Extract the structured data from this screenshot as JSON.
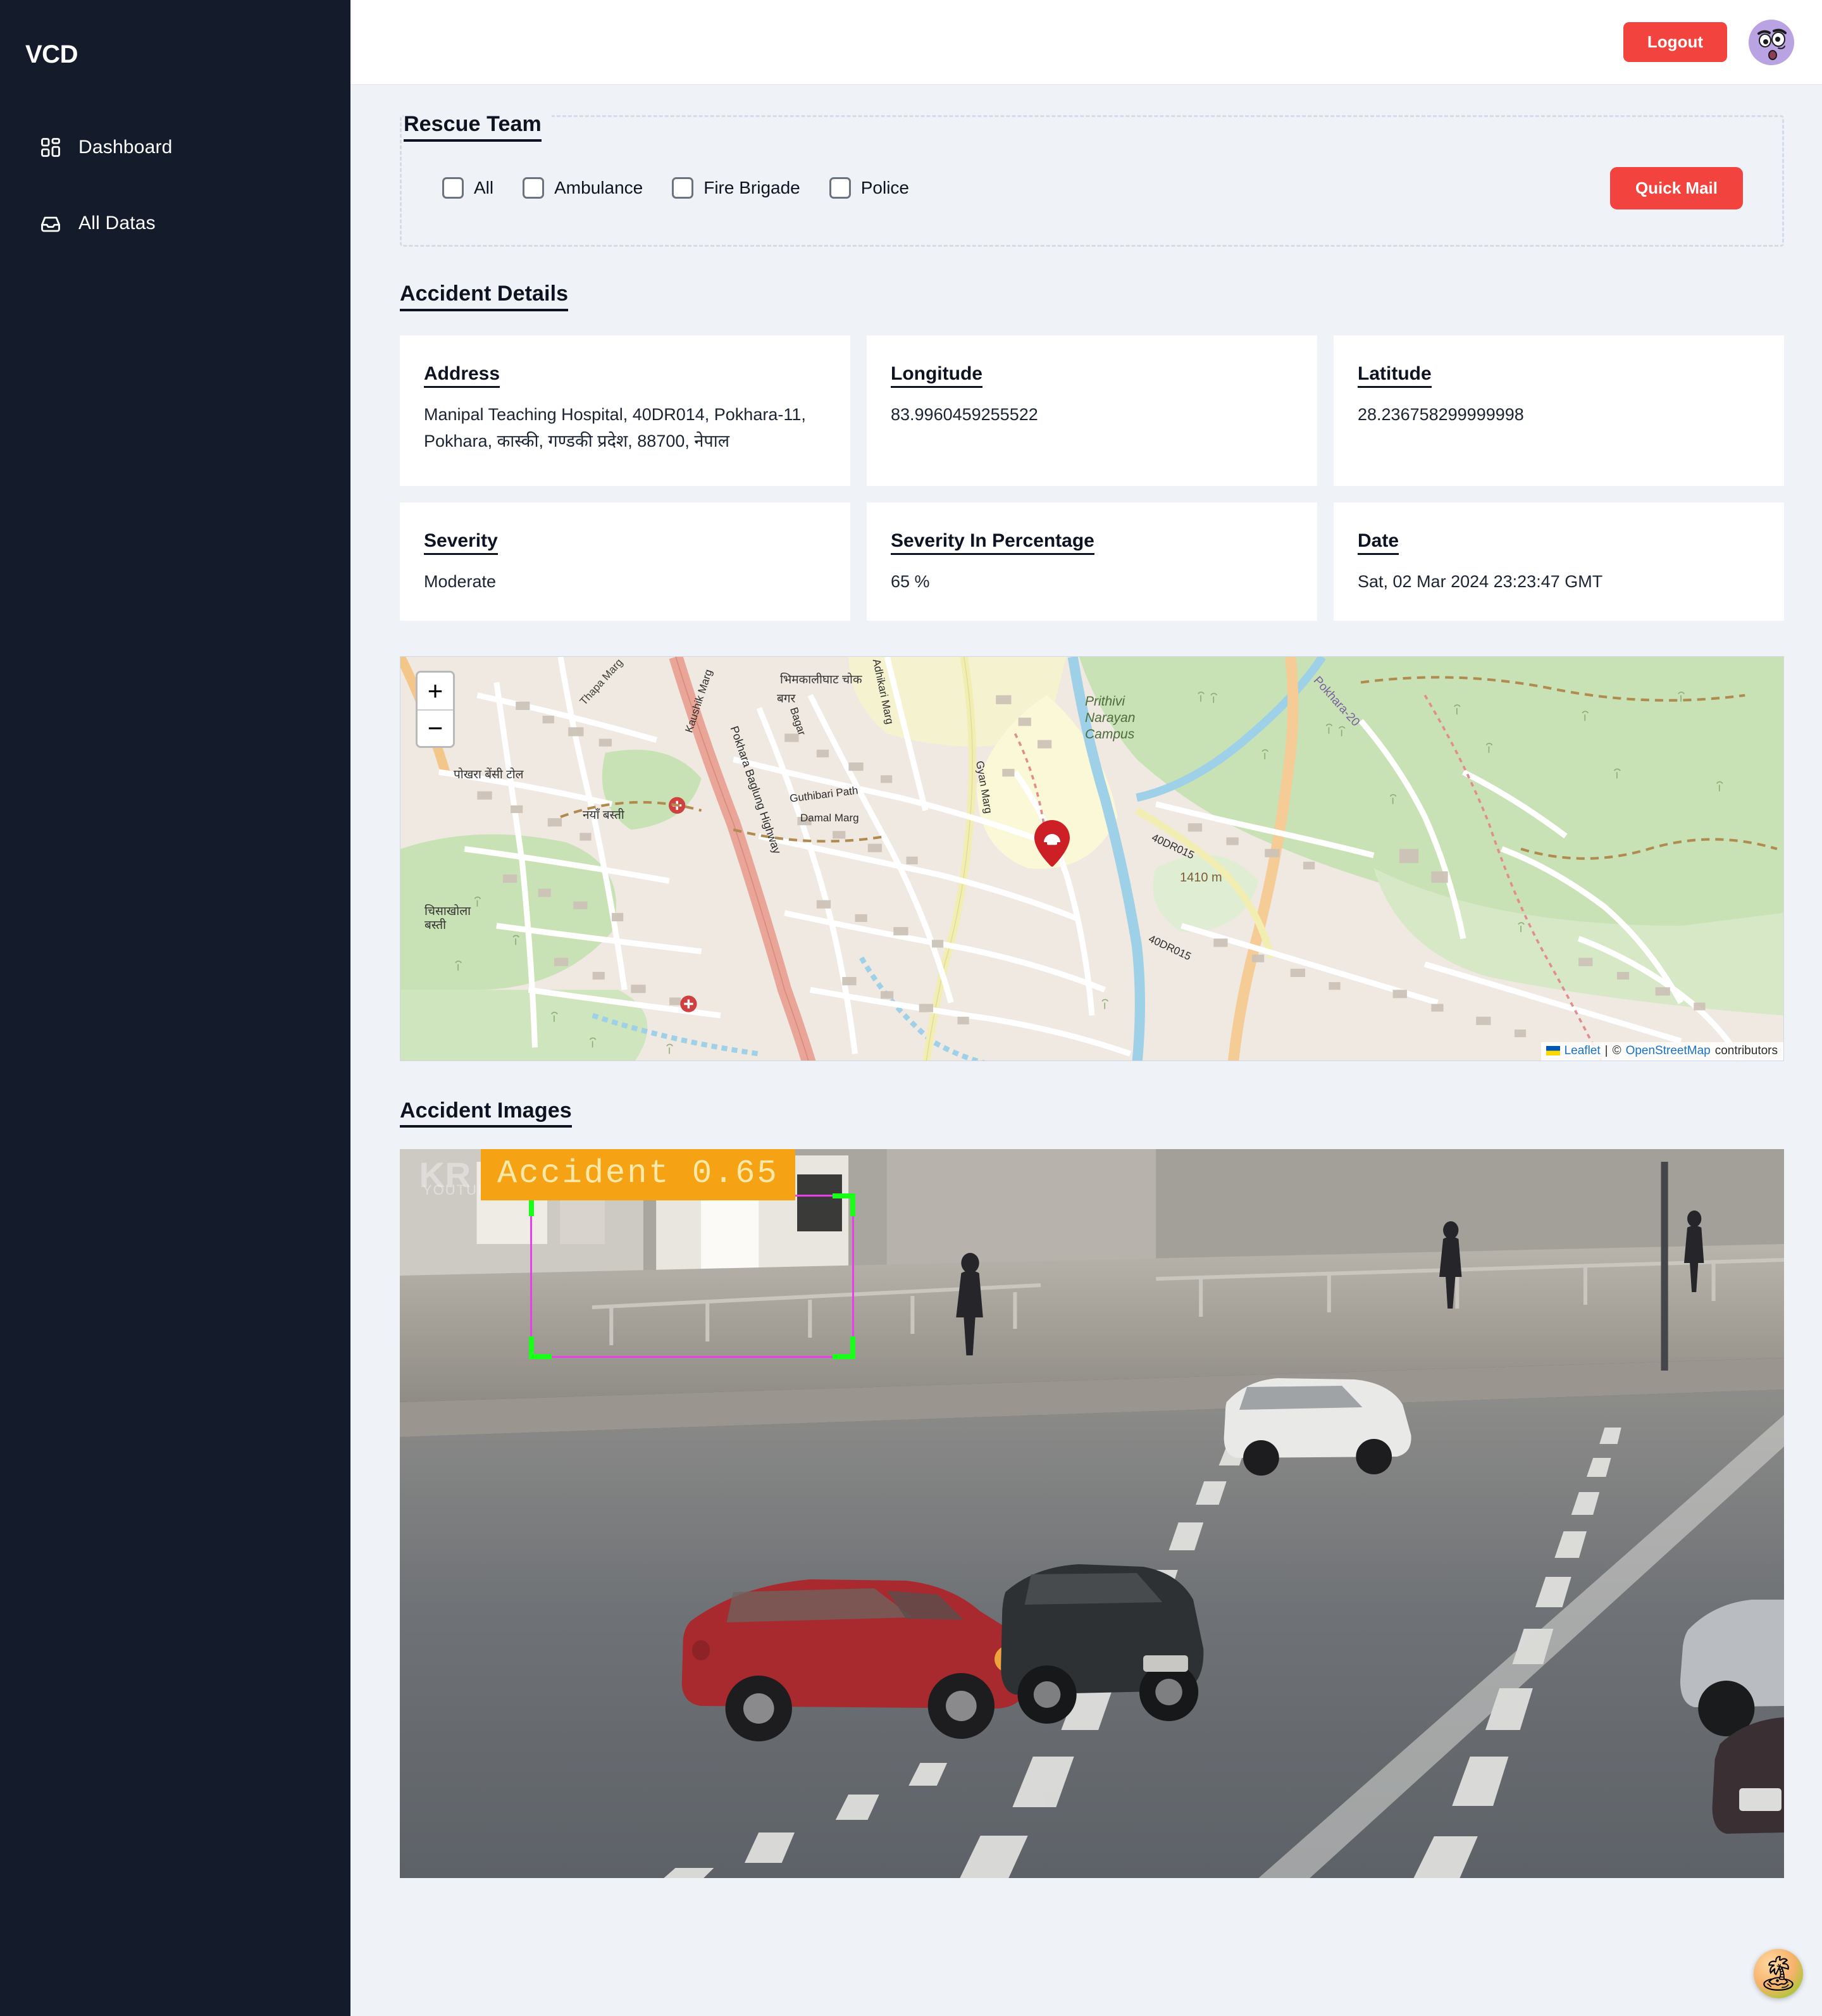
{
  "sidebar": {
    "brand": "VCD",
    "items": [
      {
        "label": "Dashboard",
        "icon": "grid-icon"
      },
      {
        "label": "All Datas",
        "icon": "inbox-icon"
      }
    ]
  },
  "topbar": {
    "logout_label": "Logout",
    "avatar_icon": "confused-face-avatar"
  },
  "rescue_team": {
    "title": "Rescue Team",
    "options": [
      {
        "label": "All",
        "checked": false
      },
      {
        "label": "Ambulance",
        "checked": false
      },
      {
        "label": "Fire Brigade",
        "checked": false
      },
      {
        "label": "Police",
        "checked": false
      }
    ],
    "quick_mail_label": "Quick Mail"
  },
  "accident_details": {
    "title": "Accident Details",
    "cards": [
      {
        "title": "Address",
        "value": "Manipal Teaching Hospital, 40DR014, Pokhara-11, Pokhara, कास्की, गण्डकी प्रदेश, 88700, नेपाल"
      },
      {
        "title": "Longitude",
        "value": "83.9960459255522"
      },
      {
        "title": "Latitude",
        "value": "28.236758299999998"
      },
      {
        "title": "Severity",
        "value": "Moderate"
      },
      {
        "title": "Severity In Percentage",
        "value": "65 %"
      },
      {
        "title": "Date",
        "value": "Sat, 02 Mar 2024 23:23:47 GMT"
      }
    ]
  },
  "map": {
    "zoom_in_label": "+",
    "zoom_out_label": "−",
    "attribution_leaflet": "Leaflet",
    "attribution_separator": "|",
    "attribution_copyright": "©",
    "attribution_osm": "OpenStreetMap",
    "attribution_contributors": "contributors",
    "labels": [
      "Thapa Marg",
      "भिमकालीघाट चोक",
      "Prithivi Narayan Campus",
      "पोखरा बेंसी टोल",
      "नयाँ बस्ती",
      "Kaushik Marg",
      "Pokhara Baglung Highway",
      "Adhikari Marg",
      "Guthibari Path",
      "Gyan Marg",
      "Damal Marg",
      "चिसाखोला बस्ती",
      "40DR015",
      "1410 m",
      "Pokhara-20",
      "Bagar",
      "बगर"
    ],
    "marker_icon": "car-accident-map-pin"
  },
  "accident_images": {
    "title": "Accident Images",
    "detection_label": "Accident 0.65",
    "detection_class": "Accident",
    "detection_confidence": "0.65",
    "watermark": "YOUTUBE CHANNEL"
  },
  "float_widget": {
    "icon": "beach-island-icon",
    "glyph": "🏝"
  },
  "colors": {
    "sidebar_bg": "#141c2b",
    "page_bg": "#eff3f8",
    "accent_red": "#f2433f",
    "card_bg": "#ffffff",
    "text_dark": "#0d1321",
    "detection_box": "#e83fe8",
    "detection_corner": "#1aff1a",
    "detection_label_bg": "#f5a314"
  }
}
